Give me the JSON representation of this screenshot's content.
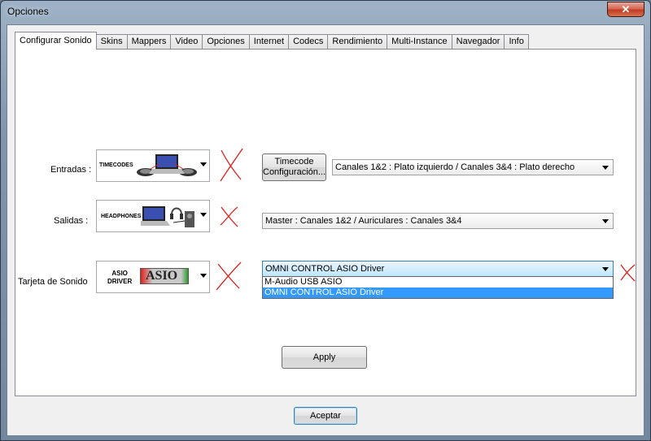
{
  "window": {
    "title": "Opciones",
    "close_glyph": "✕"
  },
  "tabs": [
    {
      "label": "Configurar Sonido",
      "active": true
    },
    {
      "label": "Skins"
    },
    {
      "label": "Mappers"
    },
    {
      "label": "Video"
    },
    {
      "label": "Opciones"
    },
    {
      "label": "Internet"
    },
    {
      "label": "Codecs"
    },
    {
      "label": "Rendimiento"
    },
    {
      "label": "Multi-Instance"
    },
    {
      "label": "Navegador"
    },
    {
      "label": "Info"
    }
  ],
  "inputs": {
    "label": "Entradas :",
    "image_combo_text": "TIMECODES",
    "timecode_button_line1": "Timecode",
    "timecode_button_line2": "Configuración...",
    "channels_value": "Canales 1&2 : Plato izquierdo / Canales 3&4 : Plato derecho"
  },
  "outputs": {
    "label": "Salidas :",
    "image_combo_text": "HEADPHONES",
    "channels_value": "Master : Canales 1&2 / Auriculares : Canales 3&4"
  },
  "soundcard": {
    "label": "Tarjeta de Sonido",
    "image_combo_text_line1": "ASIO",
    "image_combo_text_line2": "DRIVER",
    "image_logo_text": "ASIO",
    "driver_value": "OMNI CONTROL ASIO Driver",
    "options": [
      "M-Audio USB ASIO",
      "OMNI CONTROL ASIO Driver"
    ],
    "selected_index": 1
  },
  "apply_label": "Apply",
  "accept_label": "Aceptar",
  "colors": {
    "annotation_red": "#e0201b",
    "selection_blue": "#3399ff"
  }
}
